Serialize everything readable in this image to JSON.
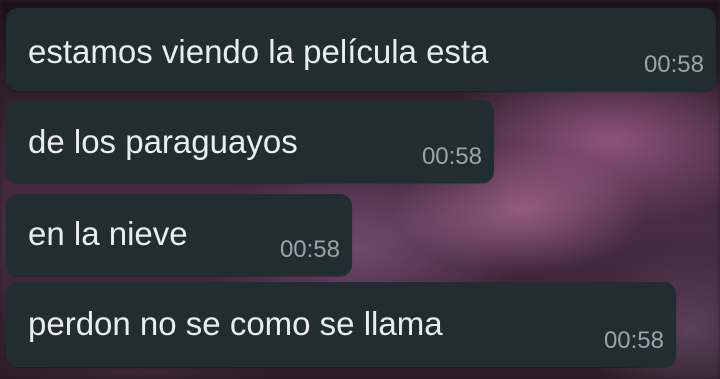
{
  "messages": [
    {
      "text": "estamos viendo la película esta",
      "time": "00:58"
    },
    {
      "text": "de los paraguayos",
      "time": "00:58"
    },
    {
      "text": "en la nieve",
      "time": "00:58"
    },
    {
      "text": "perdon no se como se llama",
      "time": "00:58"
    }
  ],
  "colors": {
    "bubble_background": "#222d32",
    "message_text": "#e9edef",
    "timestamp_text": "#9aa3a8"
  }
}
